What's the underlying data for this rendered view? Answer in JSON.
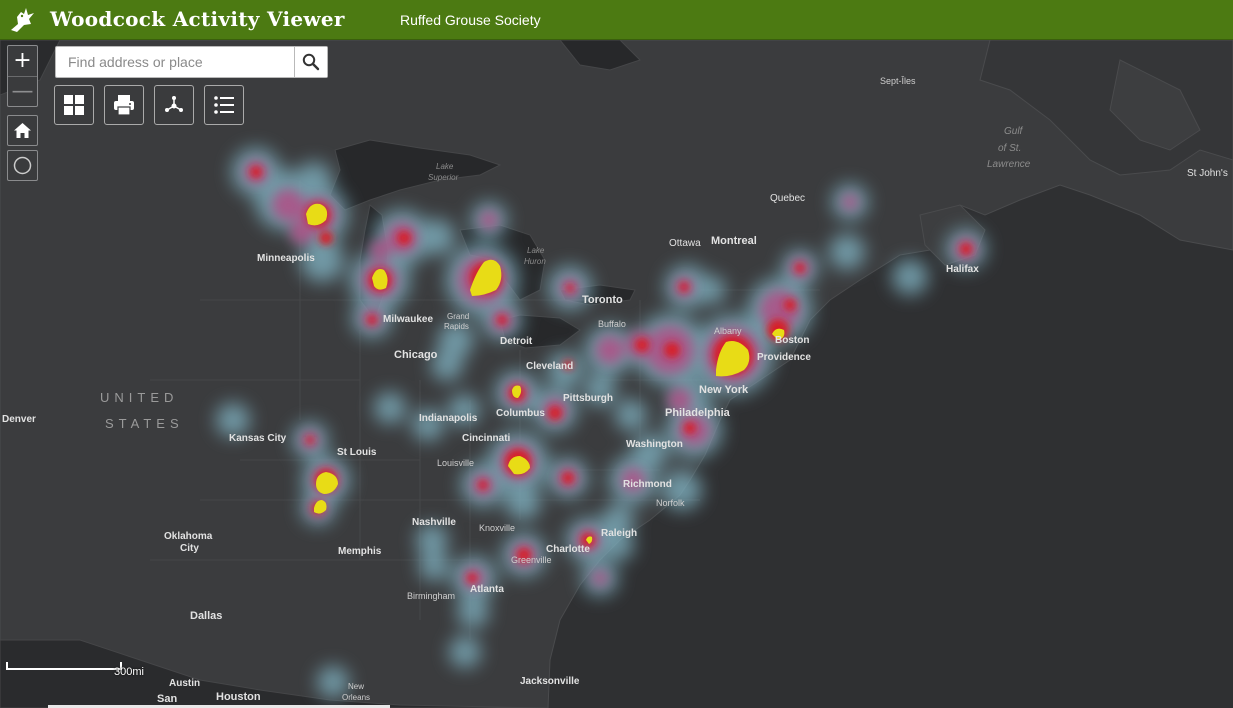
{
  "header": {
    "title": "Woodcock Activity Viewer",
    "subtitle": "Ruffed Grouse Society",
    "logo_icon": "woodcock-bird-icon",
    "bar_color": "#4c7a12"
  },
  "map_controls": {
    "zoom_in": "+",
    "zoom_out": "—",
    "home_icon": "home-icon",
    "locate_icon": "locate-icon"
  },
  "search": {
    "placeholder": "Find address or place",
    "value": "",
    "button_icon": "search-icon"
  },
  "toolbar": {
    "tools": [
      {
        "name": "basemap-gallery",
        "icon": "grid-icon"
      },
      {
        "name": "print",
        "icon": "printer-icon"
      },
      {
        "name": "share",
        "icon": "share-icon"
      },
      {
        "name": "legend",
        "icon": "list-icon"
      }
    ]
  },
  "map": {
    "basemap": "dark gray canvas",
    "heatmap_colors": [
      "#7fb0c0",
      "#a05a8a",
      "#d01c24",
      "#e6dc14"
    ],
    "labels": {
      "country_1": "UNITED",
      "country_2": "STATES",
      "sept_iles": "Sept-Îles",
      "gulf_1": "Gulf",
      "gulf_2": "of St.",
      "gulf_3": "Lawrence",
      "st_johns": "St John's",
      "quebec": "Quebec",
      "ottawa": "Ottawa",
      "montreal": "Montreal",
      "halifax": "Halifax",
      "lake_superior_1": "Lake",
      "lake_superior_2": "Superior",
      "lake_huron_1": "Lake",
      "lake_huron_2": "Huron",
      "minneapolis": "Minneapolis",
      "milwaukee": "Milwaukee",
      "grand_rapids_1": "Grand",
      "grand_rapids_2": "Rapids",
      "detroit": "Detroit",
      "chicago": "Chicago",
      "toronto": "Toronto",
      "buffalo": "Buffalo",
      "albany": "Albany",
      "boston": "Boston",
      "providence": "Providence",
      "cleveland": "Cleveland",
      "new_york": "New York",
      "pittsburgh": "Pittsburgh",
      "columbus": "Columbus",
      "philadelphia": "Philadelphia",
      "denver": "Denver",
      "indianapolis": "Indianapolis",
      "kansas_city": "Kansas City",
      "cincinnati": "Cincinnati",
      "washington": "Washington",
      "st_louis": "St Louis",
      "louisville": "Louisville",
      "richmond": "Richmond",
      "norfolk": "Norfolk",
      "nashville": "Nashville",
      "knoxville": "Knoxville",
      "raleigh": "Raleigh",
      "oklahoma_1": "Oklahoma",
      "oklahoma_2": "City",
      "memphis": "Memphis",
      "charlotte": "Charlotte",
      "greenville": "Greenville",
      "atlanta": "Atlanta",
      "birmingham": "Birmingham",
      "dallas": "Dallas",
      "jacksonville": "Jacksonville",
      "austin": "Austin",
      "san": "San",
      "houston": "Houston",
      "new_orleans_1": "New",
      "new_orleans_2": "Orleans"
    }
  },
  "scale": {
    "label": "300mi"
  }
}
